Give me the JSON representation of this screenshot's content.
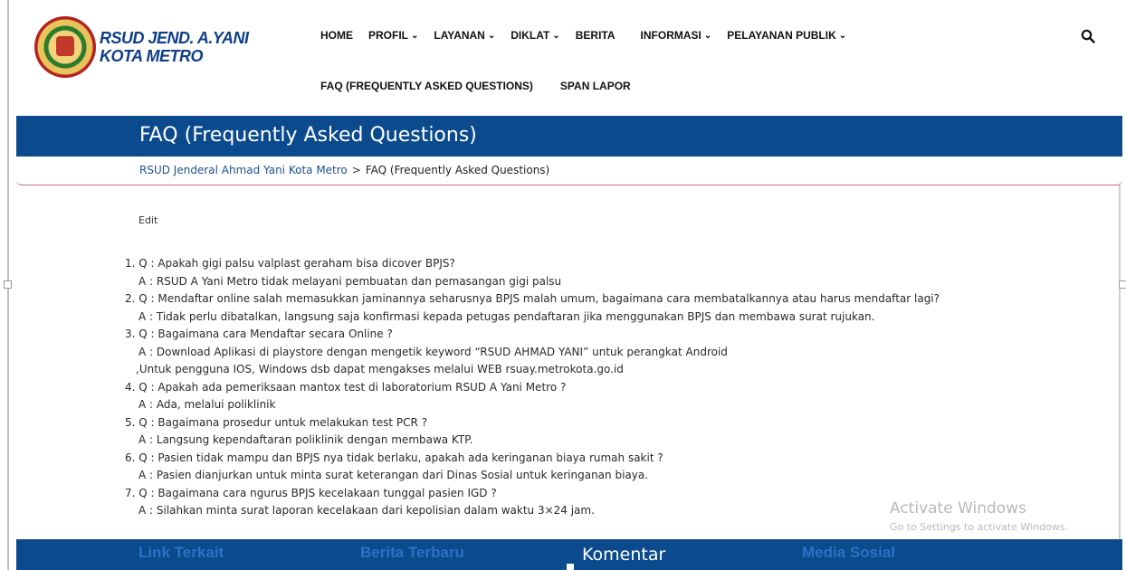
{
  "site": {
    "name_line1": "RSUD JEND. A.YANI",
    "name_line2": "KOTA METRO"
  },
  "nav": {
    "home": "HOME",
    "profil": "PROFIL",
    "layanan": "LAYANAN",
    "diklat": "DIKLAT",
    "berita": "BERITA",
    "informasi": "INFORMASI",
    "pelayanan_publik": "PELAYANAN PUBLIK",
    "faq": "FAQ (FREQUENTLY ASKED QUESTIONS)",
    "span_lapor": "SPAN LAPOR"
  },
  "page": {
    "title": "FAQ (Frequently Asked Questions)",
    "breadcrumb_home": "RSUD Jenderal Ahmad Yani Kota Metro",
    "breadcrumb_sep": ">",
    "breadcrumb_current": "FAQ (Frequently Asked Questions)",
    "edit_link": "Edit"
  },
  "faq": [
    {
      "q": "1. Q : Apakah gigi palsu valplast geraham bisa dicover BPJS?",
      "a": "A : RSUD A Yani Metro tidak melayani pembuatan dan pemasangan gigi palsu",
      "a2": ""
    },
    {
      "q": "2. Q : Mendaftar online salah memasukkan jaminannya seharusnya BPJS malah umum, bagaimana cara membatalkannya atau harus mendaftar lagi?",
      "a": "A : Tidak perlu dibatalkan, langsung saja konfirmasi kepada petugas pendaftaran jika menggunakan BPJS dan membawa surat rujukan.",
      "a2": ""
    },
    {
      "q": "3. Q : Bagaimana cara Mendaftar secara Online ?",
      "a": "A : Download Aplikasi di playstore dengan mengetik keyword “RSUD AHMAD YANI” untuk perangkat Android",
      "a2": ",Untuk pengguna IOS, Windows dsb dapat mengakses melalui WEB rsuay.metrokota.go.id"
    },
    {
      "q": "4. Q : Apakah ada pemeriksaan mantox test di laboratorium RSUD A Yani Metro ?",
      "a": "A : Ada, melalui poliklinik",
      "a2": ""
    },
    {
      "q": "5. Q : Bagaimana prosedur untuk melakukan test PCR ?",
      "a": "A : Langsung kependaftaran poliklinik dengan membawa KTP.",
      "a2": ""
    },
    {
      "q": "6. Q : Pasien tidak mampu dan BPJS nya tidak berlaku, apakah ada keringanan biaya rumah sakit ?",
      "a": "A : Pasien dianjurkan untuk minta surat keterangan dari Dinas Sosial untuk keringanan biaya.",
      "a2": ""
    },
    {
      "q": "7. Q : Bagaimana cara ngurus BPJS kecelakaan tunggal pasien IGD ?",
      "a": "A : Silahkan minta surat laporan kecelakaan dari kepolisian dalam waktu 3×24 jam.",
      "a2": ""
    }
  ],
  "footer": {
    "link_terkait": "Link Terkait",
    "berita_terbaru": "Berita Terbaru",
    "komentar": "Komentar",
    "media_sosial": "Media Sosial"
  },
  "watermark": {
    "line1": "Activate Windows",
    "line2": "Go to Settings to activate Windows."
  },
  "icons": {
    "search": "search-icon",
    "chevron": "chevron-down-icon",
    "logo": "hospital-logo-icon"
  },
  "colors": {
    "brand_blue": "#0b4a8c",
    "logo_text": "#0f3f8a",
    "footer_link": "#2a73c9",
    "breadcrumb_link": "#1d4f8f"
  }
}
